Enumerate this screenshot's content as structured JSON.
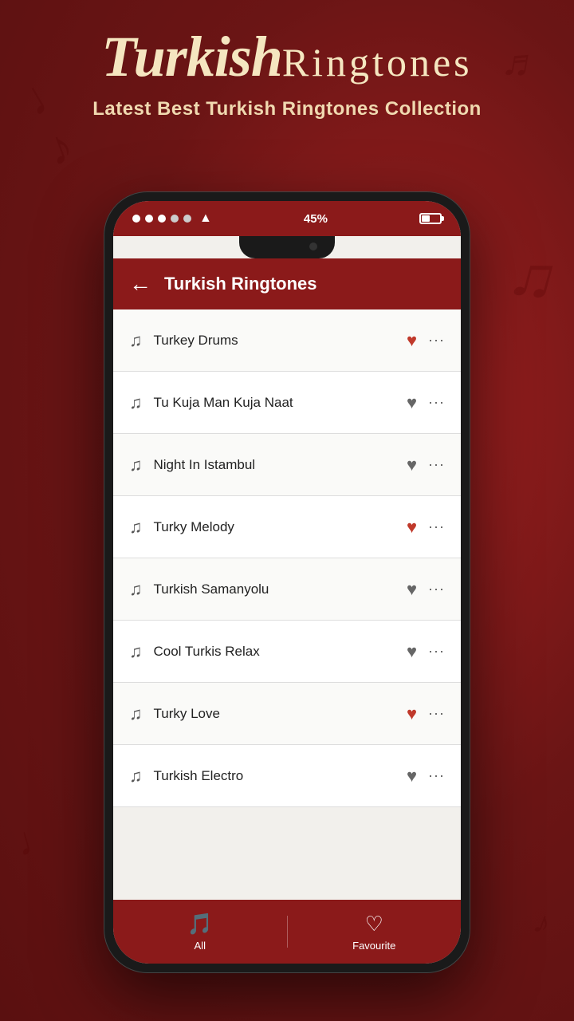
{
  "app": {
    "background_color": "#7a1a1a",
    "title_part1": "Turkish",
    "title_part2": "Ringtones",
    "subtitle": "Latest Best Turkish Ringtones Collection"
  },
  "status_bar": {
    "battery_percent": "45%",
    "signal_dots": [
      "filled",
      "filled",
      "filled",
      "empty",
      "empty"
    ],
    "wifi": "wifi"
  },
  "header": {
    "back_label": "←",
    "title": "Turkish Ringtones"
  },
  "songs": [
    {
      "id": 1,
      "name": "Turkey Drums",
      "favorited": true
    },
    {
      "id": 2,
      "name": "Tu Kuja Man Kuja Naat",
      "favorited": false
    },
    {
      "id": 3,
      "name": "Night In Istambul",
      "favorited": false
    },
    {
      "id": 4,
      "name": "Turky Melody",
      "favorited": true
    },
    {
      "id": 5,
      "name": "Turkish Samanyolu",
      "favorited": false
    },
    {
      "id": 6,
      "name": "Cool Turkis Relax",
      "favorited": false
    },
    {
      "id": 7,
      "name": "Turky Love",
      "favorited": true
    },
    {
      "id": 8,
      "name": "Turkish Electro",
      "favorited": false
    }
  ],
  "bottom_nav": {
    "items": [
      {
        "id": "all",
        "label": "All",
        "icon": "🎵"
      },
      {
        "id": "favourite",
        "label": "Favourite",
        "icon": "♡"
      }
    ]
  }
}
